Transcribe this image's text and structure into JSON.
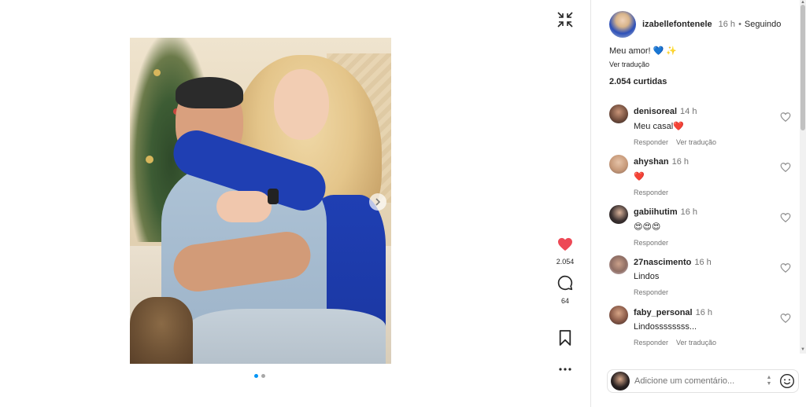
{
  "post": {
    "username": "izabellefontenele",
    "time": "16 h",
    "separator": "•",
    "follow_status": "Seguindo",
    "caption": "Meu amor! 💙 ✨",
    "translate": "Ver tradução",
    "likes_text": "2.054 curtidas"
  },
  "actions": {
    "likes_count": "2.054",
    "comments_count": "64"
  },
  "comments": [
    {
      "user": "denisoreal",
      "time": "14 h",
      "text": "Meu casal❤️",
      "reply": "Responder",
      "translate": "Ver tradução"
    },
    {
      "user": "ahyshan",
      "time": "16 h",
      "text": "❤️",
      "reply": "Responder"
    },
    {
      "user": "gabiihutim",
      "time": "16 h",
      "text": "😍😍😍",
      "reply": "Responder"
    },
    {
      "user": "27nascimento",
      "time": "16 h",
      "text": "Lindos",
      "reply": "Responder"
    },
    {
      "user": "faby_personal",
      "time": "16 h",
      "text": "Lindossssssss...",
      "reply": "Responder",
      "translate": "Ver tradução"
    }
  ],
  "composer": {
    "placeholder": "Adicione um comentário..."
  },
  "carousel": {
    "current": 1,
    "total": 2
  },
  "colors": {
    "like": "#ed4956",
    "active_dot": "#0095f6"
  }
}
